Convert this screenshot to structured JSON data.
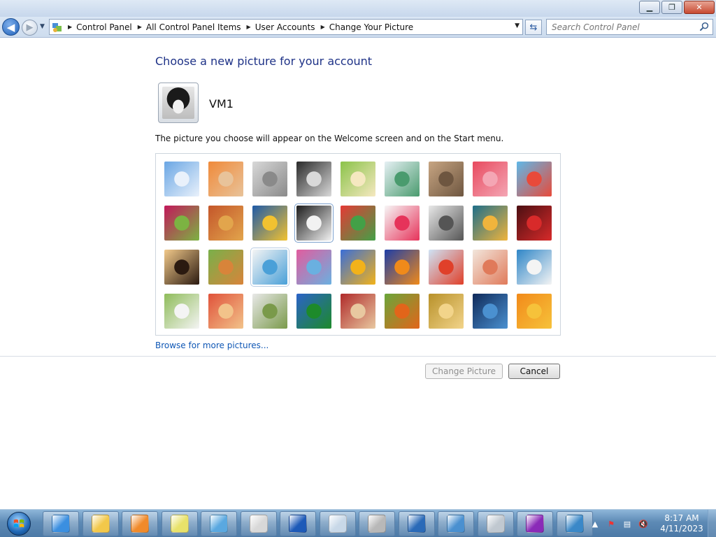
{
  "window": {
    "caption": {
      "minimize": "▁",
      "maximize": "❐",
      "close": "✕"
    }
  },
  "navigation": {
    "breadcrumbs": [
      "Control Panel",
      "All Control Panel Items",
      "User Accounts",
      "Change Your Picture"
    ],
    "search_placeholder": "Search Control Panel"
  },
  "main": {
    "heading": "Choose a new picture for your account",
    "username": "VM1",
    "description": "The picture you choose will appear on the Welcome screen and on the Start menu.",
    "browse_link": "Browse for more pictures...",
    "change_button": "Change Picture",
    "cancel_button": "Cancel",
    "selected_picture": "dog",
    "pictures": [
      {
        "name": "roller-coaster",
        "colors": [
          "#6aa6e4",
          "#e9f1fb"
        ]
      },
      {
        "name": "starfish",
        "colors": [
          "#f08a3a",
          "#e8c39a"
        ]
      },
      {
        "name": "robot",
        "colors": [
          "#d8d8d8",
          "#8a8a8a"
        ]
      },
      {
        "name": "record-player",
        "colors": [
          "#2a2a2a",
          "#d9d9d9"
        ]
      },
      {
        "name": "lucky-cat",
        "colors": [
          "#8bc34a",
          "#f5e8c0"
        ]
      },
      {
        "name": "gyroscope",
        "colors": [
          "#e6f0f4",
          "#4a9b6e"
        ]
      },
      {
        "name": "kitten",
        "colors": [
          "#c7a582",
          "#6e5640"
        ]
      },
      {
        "name": "flower",
        "colors": [
          "#e84a5f",
          "#f4a6b4"
        ]
      },
      {
        "name": "pinwheel",
        "colors": [
          "#5fb8e8",
          "#e84a3a"
        ]
      },
      {
        "name": "ball",
        "colors": [
          "#c2185b",
          "#7cb342"
        ]
      },
      {
        "name": "fabric",
        "colors": [
          "#c4562a",
          "#e2a54c"
        ]
      },
      {
        "name": "leaf",
        "colors": [
          "#1e5aa8",
          "#f2c230"
        ]
      },
      {
        "name": "dog",
        "colors": [
          "#1c1c1c",
          "#f2f2f2"
        ]
      },
      {
        "name": "crayons",
        "colors": [
          "#e53935",
          "#43a047"
        ]
      },
      {
        "name": "star",
        "colors": [
          "#f7f7f7",
          "#e6335a"
        ]
      },
      {
        "name": "jacks",
        "colors": [
          "#e8e8e8",
          "#555555"
        ]
      },
      {
        "name": "stairs",
        "colors": [
          "#1d6e8a",
          "#f0b43c"
        ]
      },
      {
        "name": "paper-crane",
        "colors": [
          "#4b0f12",
          "#d82a2a"
        ]
      },
      {
        "name": "guitar",
        "colors": [
          "#f2c98a",
          "#2b1a10"
        ]
      },
      {
        "name": "puppy",
        "colors": [
          "#79b04a",
          "#d8843a"
        ]
      },
      {
        "name": "toy-robot",
        "colors": [
          "#f4f4f4",
          "#4aa0d8"
        ]
      },
      {
        "name": "silk",
        "colors": [
          "#e25c9e",
          "#6ab0e0"
        ]
      },
      {
        "name": "sunflower",
        "colors": [
          "#3a6ed8",
          "#f2b21a"
        ]
      },
      {
        "name": "fish",
        "colors": [
          "#1d3ea8",
          "#f08a1a"
        ]
      },
      {
        "name": "balloon",
        "colors": [
          "#cfe3f5",
          "#e0402a"
        ]
      },
      {
        "name": "doll",
        "colors": [
          "#f2e6dc",
          "#e07a5a"
        ]
      },
      {
        "name": "sailboat",
        "colors": [
          "#2f86c7",
          "#f4f4f4"
        ]
      },
      {
        "name": "soccer-ball",
        "colors": [
          "#8fbc5a",
          "#f4f4f4"
        ]
      },
      {
        "name": "pattern",
        "colors": [
          "#e0523a",
          "#f2c38a"
        ]
      },
      {
        "name": "marbles",
        "colors": [
          "#e8e8e8",
          "#7a9a4a"
        ]
      },
      {
        "name": "window",
        "colors": [
          "#2b63c8",
          "#1d8a2a"
        ]
      },
      {
        "name": "rug",
        "colors": [
          "#b02a2a",
          "#e8c8a0"
        ]
      },
      {
        "name": "butterfly",
        "colors": [
          "#6aa63a",
          "#e2651a"
        ]
      },
      {
        "name": "shell",
        "colors": [
          "#b8912a",
          "#f2d48a"
        ]
      },
      {
        "name": "lighthouse",
        "colors": [
          "#0f2a5a",
          "#4a90d0"
        ]
      },
      {
        "name": "gerbera",
        "colors": [
          "#f28a1a",
          "#f6c23a"
        ]
      }
    ]
  },
  "taskbar": {
    "apps": [
      {
        "name": "internet-explorer",
        "color": "#3b8fe0"
      },
      {
        "name": "windows-explorer",
        "color": "#f2c84a"
      },
      {
        "name": "media-player",
        "color": "#f08a2a"
      },
      {
        "name": "sticky-notes",
        "color": "#e8e26a"
      },
      {
        "name": "paper-plane",
        "color": "#5aa8e0"
      },
      {
        "name": "document-file",
        "color": "#d8d8d8"
      },
      {
        "name": "help",
        "color": "#1d5ab8"
      },
      {
        "name": "calculator",
        "color": "#c8d8e8"
      },
      {
        "name": "printer",
        "color": "#b8b8b8"
      },
      {
        "name": "remote-desktop",
        "color": "#2a6ab8"
      },
      {
        "name": "control-panel",
        "color": "#4a90d0"
      },
      {
        "name": "speaker",
        "color": "#c0c8d0"
      },
      {
        "name": "display",
        "color": "#8a2ab8"
      },
      {
        "name": "network-monitor",
        "color": "#3a88c8"
      }
    ],
    "clock_time": "8:17 AM",
    "clock_date": "4/11/2023"
  }
}
